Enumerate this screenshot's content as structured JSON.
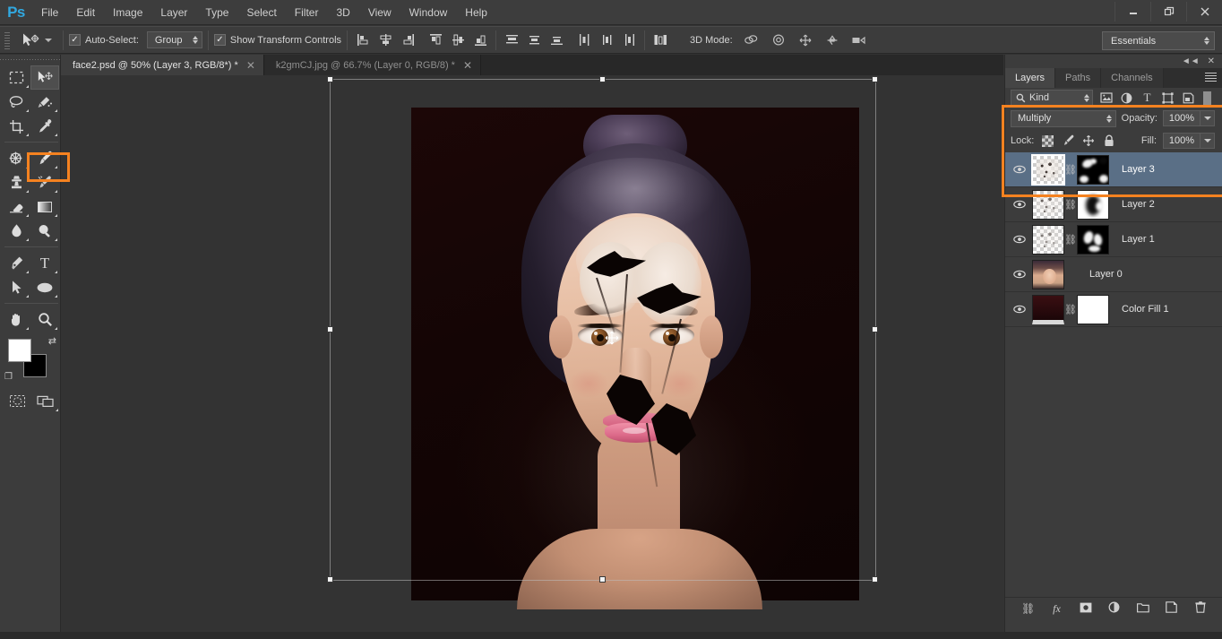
{
  "app": {
    "logo": "Ps",
    "menus": [
      "File",
      "Edit",
      "Image",
      "Layer",
      "Type",
      "Select",
      "Filter",
      "3D",
      "View",
      "Window",
      "Help"
    ],
    "window_controls": {
      "minimize": "—",
      "restore": "❐",
      "close": "✕"
    }
  },
  "options_bar": {
    "tool_icon": "move-tool-icon",
    "auto_select_checked": "✓",
    "auto_select_label": "Auto-Select:",
    "auto_select_value": "Group",
    "transform_checked": "✓",
    "transform_label": "Show Transform Controls",
    "align_icons": [
      "align-left-edges",
      "align-horizontal-centers",
      "align-right-edges",
      "align-top-edges",
      "align-vertical-centers",
      "align-bottom-edges"
    ],
    "distribute_icons": [
      "distribute-top-edges",
      "distribute-vertical-centers",
      "distribute-bottom-edges",
      "distribute-left-edges",
      "distribute-horizontal-centers",
      "distribute-right-edges"
    ],
    "auto_align_icon": "auto-align-layers",
    "mode_3d_label": "3D Mode:",
    "mode_3d_icons": [
      "rotate-3d",
      "roll-3d",
      "pan-3d",
      "slide-3d",
      "scale-3d"
    ],
    "workspace": "Essentials"
  },
  "tabs": [
    {
      "title": "face2.psd @ 50% (Layer 3, RGB/8*) *",
      "active": true,
      "close": "✕"
    },
    {
      "title": "k2gmCJ.jpg @ 66.7% (Layer 0, RGB/8) *",
      "active": false,
      "close": "✕"
    }
  ],
  "toolbar": {
    "tools": [
      {
        "name": "rectangular-marquee-tool",
        "glyph": "▭",
        "selected": false
      },
      {
        "name": "move-tool",
        "glyph": "move",
        "selected": true
      },
      {
        "name": "lasso-tool",
        "glyph": "lasso",
        "selected": false
      },
      {
        "name": "quick-selection-tool",
        "glyph": "quick-select",
        "selected": false
      },
      {
        "name": "crop-tool",
        "glyph": "crop",
        "selected": false
      },
      {
        "name": "eyedropper-tool",
        "glyph": "eyedropper",
        "selected": false
      },
      {
        "name": "spot-healing-brush-tool",
        "glyph": "healing",
        "selected": false
      },
      {
        "name": "brush-tool",
        "glyph": "brush",
        "selected": false
      },
      {
        "name": "clone-stamp-tool",
        "glyph": "stamp",
        "selected": false
      },
      {
        "name": "history-brush-tool",
        "glyph": "history-brush",
        "selected": false
      },
      {
        "name": "eraser-tool",
        "glyph": "eraser",
        "selected": false
      },
      {
        "name": "gradient-tool",
        "glyph": "gradient",
        "selected": false
      },
      {
        "name": "blur-tool",
        "glyph": "blur",
        "selected": false
      },
      {
        "name": "dodge-tool",
        "glyph": "dodge",
        "selected": false
      },
      {
        "name": "pen-tool",
        "glyph": "pen",
        "selected": false
      },
      {
        "name": "type-tool",
        "glyph": "T",
        "selected": false
      },
      {
        "name": "path-selection-tool",
        "glyph": "path-arrow",
        "selected": false
      },
      {
        "name": "ellipse-tool",
        "glyph": "ellipse",
        "selected": false
      },
      {
        "name": "hand-tool",
        "glyph": "hand",
        "selected": false
      },
      {
        "name": "zoom-tool",
        "glyph": "zoom",
        "selected": false
      }
    ],
    "foreground_color": "#ffffff",
    "background_color": "#000000",
    "quick_mask_icon": "quick-mask-mode",
    "screen_mode_icon": "screen-mode"
  },
  "canvas": {
    "document": "face2.psd",
    "zoom_level": "50%",
    "artwork_description": "portrait of a woman with cracked-stone face texture on dark maroon background",
    "transform_handles": 8,
    "cursor": "move-crosshair"
  },
  "layers_panel": {
    "tabs": [
      {
        "label": "Layers",
        "active": true
      },
      {
        "label": "Paths",
        "active": false
      },
      {
        "label": "Channels",
        "active": false
      }
    ],
    "collapse_icon": "◄◄",
    "close_icon": "✕",
    "menu_icon": "panel-menu-icon",
    "filter": {
      "search_icon": "search-icon",
      "kind_label": "Kind",
      "type_icons": [
        "pixel-layer-filter",
        "adjustment-layer-filter",
        "type-layer-filter",
        "shape-layer-filter",
        "smart-object-filter"
      ],
      "toggle": "filter-toggle"
    },
    "blend_mode": "Multiply",
    "opacity_label": "Opacity:",
    "opacity_value": "100%",
    "lock_label": "Lock:",
    "lock_icons": [
      "lock-transparent-pixels",
      "lock-image-pixels",
      "lock-position",
      "lock-all"
    ],
    "fill_label": "Fill:",
    "fill_value": "100%",
    "layers": [
      {
        "name": "Layer 3",
        "visible": true,
        "selected": true,
        "has_mask": true,
        "linked": true,
        "thumb": "spatter"
      },
      {
        "name": "Layer 2",
        "visible": true,
        "selected": false,
        "has_mask": true,
        "linked": true,
        "thumb": "spatter"
      },
      {
        "name": "Layer 1",
        "visible": true,
        "selected": false,
        "has_mask": true,
        "linked": true,
        "thumb": "spatter"
      },
      {
        "name": "Layer 0",
        "visible": true,
        "selected": false,
        "has_mask": false,
        "linked": false,
        "thumb": "photo"
      },
      {
        "name": "Color Fill 1",
        "visible": true,
        "selected": false,
        "has_mask": true,
        "linked": true,
        "thumb": "fill"
      }
    ],
    "footer_icons": [
      "link-layers-icon",
      "layer-style-fx-icon",
      "add-layer-mask-icon",
      "new-adjustment-layer-icon",
      "new-group-icon",
      "new-layer-icon",
      "delete-layer-icon"
    ]
  },
  "annotations": {
    "highlight_color": "#f58220",
    "regions": [
      {
        "name": "brush-tool-highlight",
        "target": "brush-tool"
      },
      {
        "name": "blend-mode-and-layer-highlight",
        "target": "multiply-blend-mode-and-layer-3"
      }
    ]
  }
}
